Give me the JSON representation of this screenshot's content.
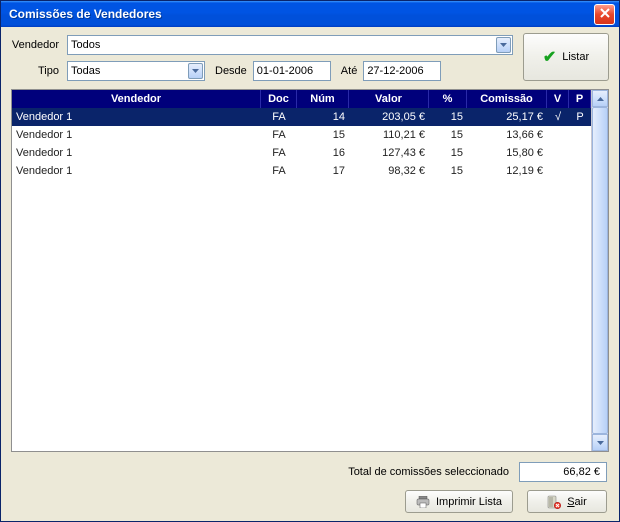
{
  "window": {
    "title": "Comissões de Vendedores"
  },
  "filters": {
    "vendedor_label": "Vendedor",
    "vendedor_value": "Todos",
    "tipo_label": "Tipo",
    "tipo_value": "Todas",
    "desde_label": "Desde",
    "desde_value": "01-01-2006",
    "ate_label": "Até",
    "ate_value": "27-12-2006"
  },
  "buttons": {
    "listar": "Listar",
    "imprimir": "Imprimir Lista",
    "sair": "Sair"
  },
  "grid": {
    "headers": {
      "vendedor": "Vendedor",
      "doc": "Doc",
      "num": "Núm",
      "valor": "Valor",
      "pct": "%",
      "comissao": "Comissão",
      "v": "V",
      "p": "P"
    },
    "rows": [
      {
        "vendedor": "Vendedor 1",
        "doc": "FA",
        "num": "14",
        "valor": "203,05 €",
        "pct": "15",
        "comissao": "25,17 €",
        "v": "√",
        "p": "P",
        "selected": true
      },
      {
        "vendedor": "Vendedor 1",
        "doc": "FA",
        "num": "15",
        "valor": "110,21 €",
        "pct": "15",
        "comissao": "13,66 €",
        "v": "",
        "p": "",
        "selected": false
      },
      {
        "vendedor": "Vendedor 1",
        "doc": "FA",
        "num": "16",
        "valor": "127,43 €",
        "pct": "15",
        "comissao": "15,80 €",
        "v": "",
        "p": "",
        "selected": false
      },
      {
        "vendedor": "Vendedor 1",
        "doc": "FA",
        "num": "17",
        "valor": "98,32 €",
        "pct": "15",
        "comissao": "12,19 €",
        "v": "",
        "p": "",
        "selected": false
      }
    ]
  },
  "totals": {
    "label": "Total de comissões seleccionado",
    "value": "66,82 €"
  }
}
